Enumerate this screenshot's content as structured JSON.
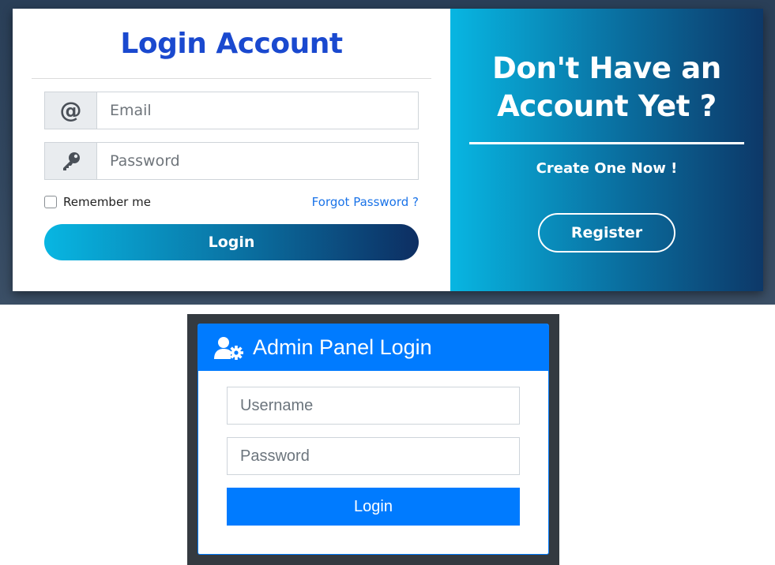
{
  "login_card": {
    "title": "Login Account",
    "email": {
      "placeholder": "Email",
      "icon": "at-icon"
    },
    "password": {
      "placeholder": "Password",
      "icon": "key-icon"
    },
    "remember_label": "Remember me",
    "forgot_label": "Forgot Password ?",
    "login_label": "Login",
    "colors": {
      "title": "#1a49cf",
      "link": "#1a73e8",
      "gradient_start": "#08b6e2",
      "gradient_end": "#0d3868"
    }
  },
  "promo": {
    "title_line1": "Don't Have an",
    "title_line2": "Account Yet ?",
    "subtitle": "Create One Now !",
    "register_label": "Register"
  },
  "admin_panel": {
    "title": "Admin Panel Login",
    "icon": "user-gear-icon",
    "username_placeholder": "Username",
    "password_placeholder": "Password",
    "login_label": "Login",
    "colors": {
      "primary": "#007bff",
      "frame": "#343a40"
    }
  }
}
